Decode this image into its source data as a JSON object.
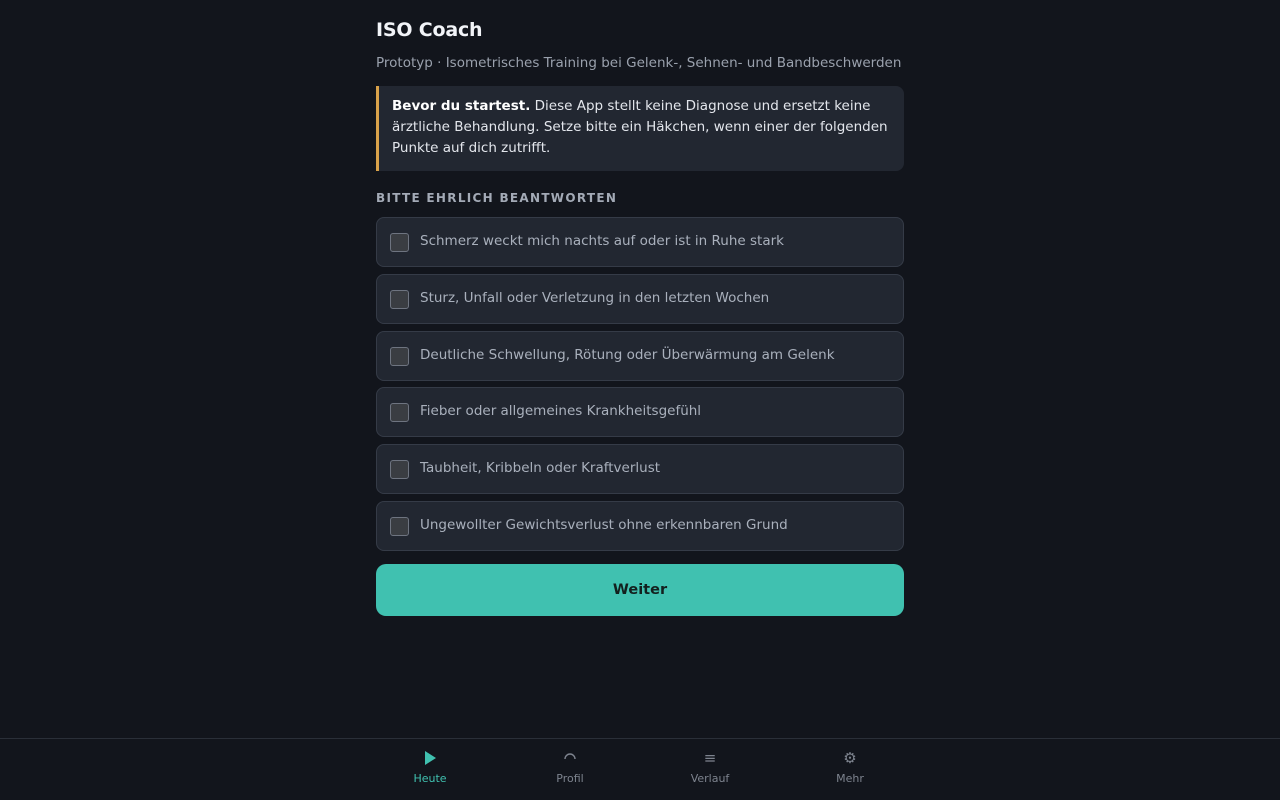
{
  "header": {
    "title": "ISO Coach",
    "subtitle": "Prototyp · Isometrisches Training bei Gelenk-, Sehnen- und Bandbeschwerden"
  },
  "notice": {
    "lead": "Bevor du startest.",
    "text": " Diese App stellt keine Diagnose und ersetzt keine ärztliche Behandlung. Setze bitte ein Häkchen, wenn einer der folgenden Punkte auf dich zutrifft.",
    "accent_color": "#d9a24a"
  },
  "questionnaire": {
    "heading": "BITTE EHRLICH BEANTWORTEN",
    "items": [
      {
        "label": "Schmerz weckt mich nachts auf oder ist in Ruhe stark",
        "checked": false
      },
      {
        "label": "Sturz, Unfall oder Verletzung in den letzten Wochen",
        "checked": false
      },
      {
        "label": "Deutliche Schwellung, Rötung oder Überwärmung am Gelenk",
        "checked": false
      },
      {
        "label": "Fieber oder allgemeines Krankheitsgefühl",
        "checked": false
      },
      {
        "label": "Taubheit, Kribbeln oder Kraftverlust",
        "checked": false
      },
      {
        "label": "Ungewollter Gewichtsverlust ohne erkennbaren Grund",
        "checked": false
      }
    ],
    "continue_label": "Weiter"
  },
  "nav": {
    "active": "Heute",
    "accent_color": "#40c1b0",
    "items": [
      {
        "label": "Heute",
        "icon": "play-icon"
      },
      {
        "label": "Profil",
        "icon": "profile-icon"
      },
      {
        "label": "Verlauf",
        "icon": "history-icon"
      },
      {
        "label": "Mehr",
        "icon": "gear-icon"
      }
    ]
  }
}
